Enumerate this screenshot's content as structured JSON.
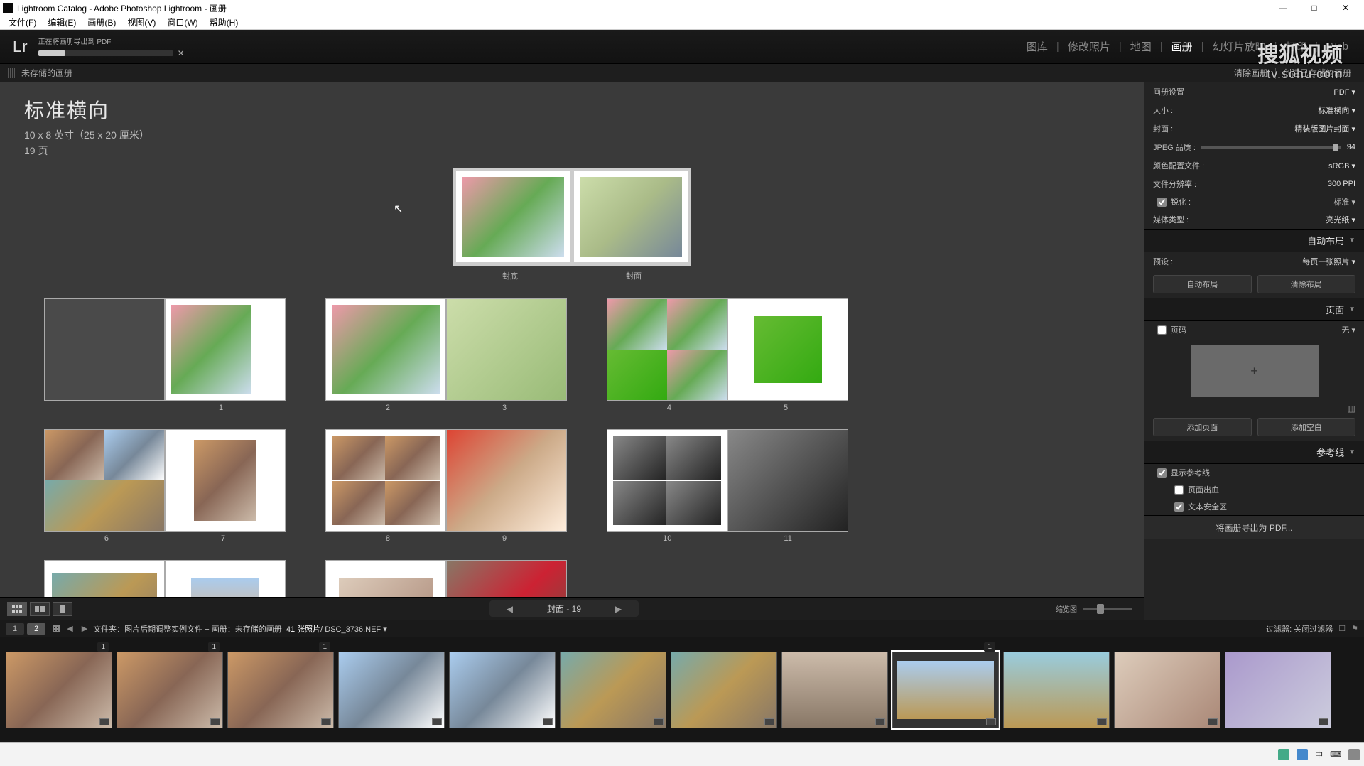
{
  "window": {
    "title": "Lightroom Catalog - Adobe Photoshop Lightroom - 画册",
    "min": "—",
    "max": "□",
    "close": "✕"
  },
  "menu": {
    "items": [
      "文件(F)",
      "编辑(E)",
      "画册(B)",
      "视图(V)",
      "窗口(W)",
      "帮助(H)"
    ]
  },
  "appbar": {
    "logo": "Lr",
    "progress_label": "正在将画册导出到 PDF",
    "modules": [
      "图库",
      "修改照片",
      "地图",
      "画册",
      "幻灯片放映",
      "打印",
      "Web"
    ],
    "active": "画册"
  },
  "watermark": {
    "line1": "搜狐视频",
    "line2": "tv.sohu.com"
  },
  "subbar": {
    "title": "未存储的画册",
    "clear": "清除画册",
    "create": "创建已存储的画册"
  },
  "book": {
    "title": "标准横向",
    "size": "10 x 8 英寸（25 x 20 厘米）",
    "pages": "19 页",
    "cover_back": "封底",
    "cover_front": "封面",
    "pager": "封面 - 19"
  },
  "right": {
    "sec_settings": "画册设置",
    "export_pdf": "PDF ▾",
    "size_lbl": "大小 :",
    "size_val": "标准横向 ▾",
    "cover_lbl": "封面 :",
    "cover_val": "精装版图片封面 ▾",
    "jpeg_lbl": "JPEG 品质 :",
    "jpeg_val": "94",
    "color_lbl": "颜色配置文件 :",
    "color_val": "sRGB ▾",
    "res_lbl": "文件分辨率 :",
    "res_val": "300 PPI",
    "sharp_lbl": "锐化 :",
    "sharp_val": "标准 ▾",
    "sharp_chk": "锐化 :",
    "media_lbl": "媒体类型 :",
    "media_val": "亮光纸 ▾",
    "sec_auto": "自动布局",
    "preset_lbl": "预设 :",
    "preset_val": "每页一张照片 ▾",
    "auto_btn": "自动布局",
    "clear_btn": "清除布局",
    "sec_page": "页面",
    "page_chk": "页码",
    "page_type": "无 ▾",
    "add_page": "添加页面",
    "add_blank": "添加空白",
    "sec_guides": "参考线",
    "guides_chk": "显示参考线",
    "guide_bleed": "页面出血",
    "guide_text": "文本安全区",
    "export_btn": "将画册导出为 PDF..."
  },
  "bread": {
    "t1": "1",
    "t2": "2",
    "path": "文件夹：图片后期调整实例文件 + 画册：未存储的画册",
    "count": "41 张照片",
    "file": "/ DSC_3736.NEF ▾",
    "filter_lbl": "过滤器:",
    "filter_val": "关闭过滤器"
  },
  "tray": {
    "ime": "中",
    "net": "⌨"
  }
}
